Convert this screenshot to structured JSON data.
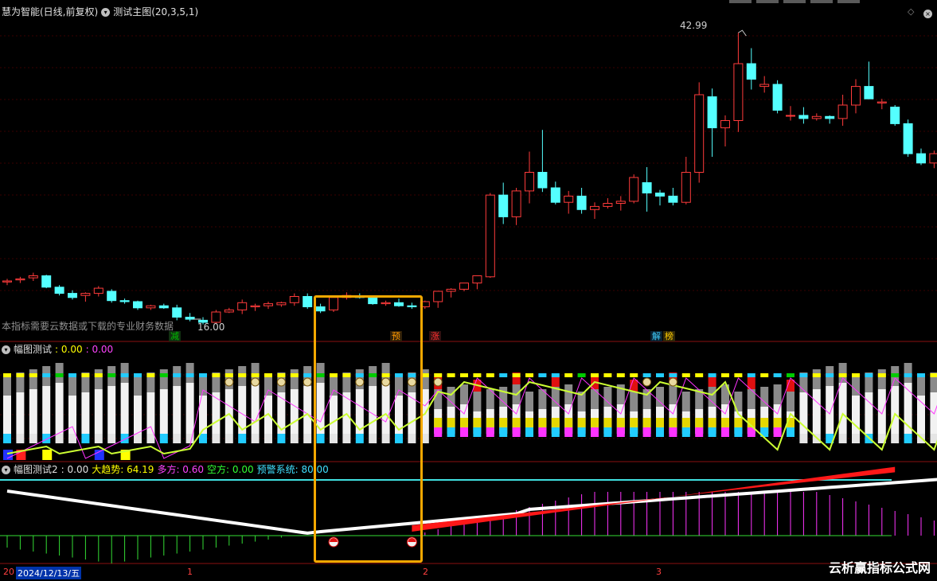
{
  "main_panel": {
    "title": "慧为智能(日线,前复权)",
    "indicator": "测试主图(20,3,5,1)",
    "high_label": "42.99",
    "low_label": "16.00",
    "note": "本指标需要云数据或下载的专业财务数据",
    "tags": [
      {
        "text": "减",
        "color": "#00c000"
      },
      {
        "text": "预",
        "color": "#ff9900"
      },
      {
        "text": "涨",
        "color": "#ff3030"
      },
      {
        "text": "解",
        "color": "#40d0ff"
      },
      {
        "text": "榜",
        "color": "#ffcc00"
      }
    ]
  },
  "panel2": {
    "name": "幅图测试",
    "v1": ": 0.00",
    "v2": ": 0.00"
  },
  "panel3": {
    "name": "幅图测试2",
    "v0": ": 0.00",
    "trend_label": "大趋势: 64.19",
    "long_label": "多方: 0.60",
    "short_label": "空方: 0.00",
    "warn_label": "预警系统: 80.00"
  },
  "x_axis": {
    "date_box": "2024/12/13/五",
    "prefix": "20",
    "ticks": [
      "1",
      "2",
      "3"
    ]
  },
  "watermark": "云析赢指标公式网",
  "colors": {
    "up": "#ff3b3b",
    "down": "#54ffff",
    "yellow": "#ffff00",
    "magenta": "#ff33ff",
    "green_line": "#33dd33",
    "accent": "#f5a800"
  },
  "chart_data": {
    "type": "candlestick",
    "ohlc": [
      [
        18.9,
        19.2,
        18.6,
        19.0
      ],
      [
        19.1,
        19.4,
        18.8,
        19.2
      ],
      [
        19.3,
        19.8,
        19.0,
        19.5
      ],
      [
        19.5,
        19.6,
        18.3,
        18.4
      ],
      [
        18.4,
        18.6,
        17.6,
        17.8
      ],
      [
        17.8,
        18.1,
        17.2,
        17.4
      ],
      [
        17.6,
        17.9,
        17.0,
        17.8
      ],
      [
        17.8,
        18.5,
        17.5,
        18.3
      ],
      [
        18.0,
        18.2,
        16.9,
        17.1
      ],
      [
        17.1,
        17.3,
        16.8,
        17.0
      ],
      [
        17.0,
        17.1,
        16.2,
        16.4
      ],
      [
        16.4,
        16.7,
        16.2,
        16.6
      ],
      [
        16.6,
        16.8,
        16.3,
        16.4
      ],
      [
        16.4,
        16.7,
        15.2,
        15.5
      ],
      [
        15.5,
        15.9,
        15.1,
        15.3
      ],
      [
        15.2,
        15.5,
        14.8,
        15.0
      ],
      [
        15.0,
        16.2,
        14.9,
        16.0
      ],
      [
        16.0,
        16.4,
        15.9,
        16.2
      ],
      [
        16.2,
        17.2,
        15.8,
        16.9
      ],
      [
        16.5,
        16.8,
        16.1,
        16.6
      ],
      [
        16.6,
        17.0,
        16.3,
        16.8
      ],
      [
        16.7,
        17.0,
        16.5,
        16.9
      ],
      [
        16.9,
        17.8,
        16.6,
        17.5
      ],
      [
        17.5,
        17.8,
        16.3,
        16.5
      ],
      [
        16.5,
        16.8,
        15.9,
        16.1
      ],
      [
        16.2,
        17.6,
        16.0,
        17.4
      ],
      [
        17.4,
        17.9,
        17.2,
        17.6
      ],
      [
        17.5,
        17.8,
        17.3,
        17.4
      ],
      [
        17.4,
        17.6,
        16.7,
        16.8
      ],
      [
        16.8,
        17.1,
        16.6,
        16.9
      ],
      [
        16.9,
        17.3,
        16.5,
        16.6
      ],
      [
        16.6,
        16.9,
        16.3,
        16.5
      ],
      [
        16.5,
        17.1,
        16.3,
        17.0
      ],
      [
        17.0,
        18.0,
        16.4,
        18.0
      ],
      [
        18.0,
        18.3,
        17.4,
        18.2
      ],
      [
        18.2,
        18.8,
        18.0,
        18.8
      ],
      [
        18.8,
        19.5,
        18.2,
        19.5
      ],
      [
        19.4,
        27.5,
        19.3,
        27.3
      ],
      [
        27.3,
        28.5,
        24.5,
        25.2
      ],
      [
        25.2,
        28.0,
        24.4,
        27.7
      ],
      [
        27.7,
        31.5,
        26.5,
        29.5
      ],
      [
        29.5,
        33.6,
        27.6,
        28.0
      ],
      [
        28.0,
        28.6,
        26.4,
        26.6
      ],
      [
        26.6,
        27.7,
        25.5,
        27.2
      ],
      [
        27.2,
        28.0,
        25.5,
        25.9
      ],
      [
        25.9,
        26.6,
        25.0,
        26.2
      ],
      [
        26.2,
        27.0,
        26.0,
        26.5
      ],
      [
        26.5,
        27.2,
        25.8,
        26.7
      ],
      [
        26.7,
        29.3,
        26.5,
        29.0
      ],
      [
        28.5,
        30.0,
        25.7,
        27.5
      ],
      [
        27.5,
        27.8,
        26.3,
        27.2
      ],
      [
        27.2,
        28.0,
        26.3,
        26.6
      ],
      [
        26.6,
        31.0,
        26.4,
        29.5
      ],
      [
        29.5,
        38.2,
        28.5,
        37.0
      ],
      [
        36.8,
        37.6,
        31.0,
        33.8
      ],
      [
        33.8,
        35.0,
        32.0,
        34.5
      ],
      [
        34.5,
        42.99,
        33.4,
        40.0
      ],
      [
        40.0,
        41.5,
        37.5,
        38.5
      ],
      [
        37.8,
        38.8,
        37.2,
        38.0
      ],
      [
        38.0,
        38.4,
        35.2,
        35.5
      ],
      [
        35.0,
        35.9,
        34.5,
        35.0
      ],
      [
        35.0,
        35.8,
        34.2,
        34.7
      ],
      [
        34.7,
        35.2,
        34.5,
        34.9
      ],
      [
        34.9,
        35.0,
        34.2,
        34.7
      ],
      [
        34.7,
        37.0,
        34.0,
        36.0
      ],
      [
        36.0,
        38.5,
        35.2,
        37.8
      ],
      [
        37.8,
        40.2,
        36.6,
        36.6
      ],
      [
        36.2,
        36.6,
        35.6,
        36.3
      ],
      [
        35.8,
        36.0,
        34.0,
        34.2
      ],
      [
        34.2,
        34.6,
        31.0,
        31.3
      ],
      [
        31.3,
        31.8,
        30.2,
        30.4
      ],
      [
        30.4,
        31.6,
        29.9,
        31.3
      ],
      [
        31.0,
        31.3,
        30.6,
        30.8
      ],
      [
        30.8,
        31.4,
        29.8,
        30.1
      ],
      [
        30.0,
        30.4,
        28.8,
        29.5
      ]
    ],
    "y_range": [
      14,
      44
    ],
    "high_annotation": 42.99,
    "low_annotation": 16.0
  }
}
